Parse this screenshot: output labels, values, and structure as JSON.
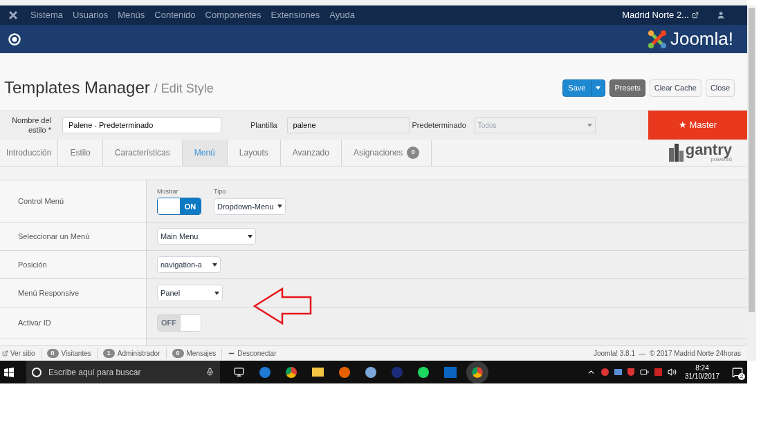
{
  "top_menu": {
    "items": [
      "Sistema",
      "Usuarios",
      "Menús",
      "Contenido",
      "Componentes",
      "Extensiones",
      "Ayuda"
    ],
    "site": "Madrid Norte 2..."
  },
  "header": {
    "logo": "Joomla!"
  },
  "toolbar": {
    "title": "Templates Manager",
    "subtitle": "/ Edit Style",
    "buttons": [
      {
        "label": "Save",
        "kind": "primary"
      },
      {
        "label": "Presets",
        "kind": "dark"
      },
      {
        "label": "Clear Cache",
        "kind": "default"
      },
      {
        "label": "Close",
        "kind": "default"
      }
    ]
  },
  "style_form": {
    "name_label": "Nombre del estilo *",
    "name_value": "Palene - Predeterminado",
    "template_label": "Plantilla",
    "template_value": "palene",
    "default_label": "Predeterminado",
    "default_value": "Todos",
    "master": "★ Master"
  },
  "tabs": [
    {
      "label": "Introducción",
      "selected": false
    },
    {
      "label": "Estilo",
      "selected": false
    },
    {
      "label": "Características",
      "selected": false
    },
    {
      "label": "Menú",
      "selected": true
    },
    {
      "label": "Layouts",
      "selected": false
    },
    {
      "label": "Avanzado",
      "selected": false
    },
    {
      "label": "Asignaciones",
      "selected": false,
      "badge": "0"
    }
  ],
  "brand": {
    "name": "gantry",
    "tagline": "powered"
  },
  "settings": [
    {
      "label": "Control Menú",
      "kind": "toggle_select",
      "toggle_label": "Mostrar",
      "on": true,
      "on_text": "ON",
      "select_label": "Tipo",
      "value": "Dropdown-Menu"
    },
    {
      "label": "Seleccionar un Menú",
      "kind": "select",
      "value": "Main Menu"
    },
    {
      "label": "Posición",
      "kind": "select",
      "value": "navigation-a"
    },
    {
      "label": "Menú Responsive",
      "kind": "select",
      "value": "Panel"
    },
    {
      "label": "Activar ID",
      "kind": "toggle",
      "on": false,
      "off_text": "OFF"
    }
  ],
  "status_bar": {
    "left": [
      {
        "label": "Ver sitio",
        "kind": "link"
      },
      {
        "label": "Visitantes",
        "count": "0"
      },
      {
        "label": "Administrador",
        "count": "1"
      },
      {
        "label": "Mensajes",
        "count": "0"
      },
      {
        "label": "Desconectar",
        "kind": "logout"
      }
    ],
    "right": "Joomla! 3.8.1  —  © 2017 Madrid Norte 24horas"
  },
  "taskbar": {
    "search_placeholder": "Escribe aquí para buscar",
    "time": "8:24",
    "date": "31/10/2017",
    "notifications": "2"
  }
}
